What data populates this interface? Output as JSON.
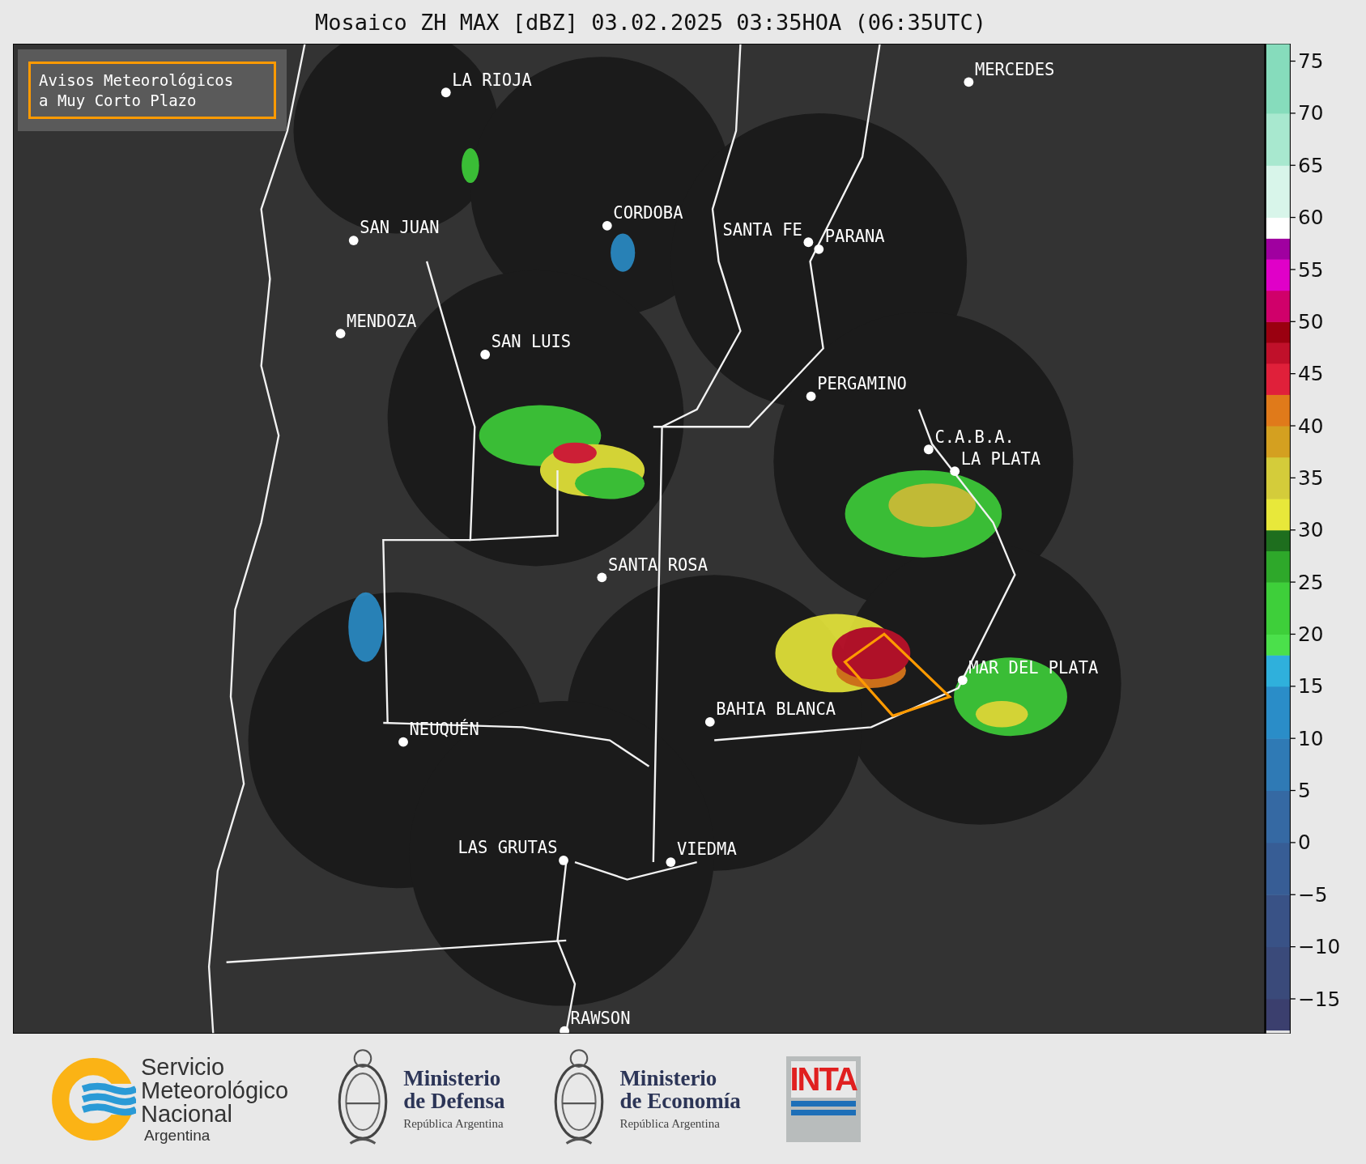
{
  "title": "Mosaico ZH MAX [dBZ] 03.02.2025 03:35HOA (06:35UTC)",
  "legend": {
    "lines": [
      "Avisos Meteorológicos",
      "a Muy Corto Plazo"
    ]
  },
  "cities": [
    {
      "name": "LA RIOJA"
    },
    {
      "name": "MERCEDES"
    },
    {
      "name": "SAN JUAN"
    },
    {
      "name": "CORDOBA"
    },
    {
      "name": "SANTA FE"
    },
    {
      "name": "PARANA"
    },
    {
      "name": "MENDOZA"
    },
    {
      "name": "SAN LUIS"
    },
    {
      "name": "PERGAMINO"
    },
    {
      "name": "C.A.B.A."
    },
    {
      "name": "LA PLATA"
    },
    {
      "name": "SANTA ROSA"
    },
    {
      "name": "MAR DEL PLATA"
    },
    {
      "name": "BAHIA BLANCA"
    },
    {
      "name": "NEUQUÉN"
    },
    {
      "name": "LAS GRUTAS"
    },
    {
      "name": "VIEDMA"
    },
    {
      "name": "RAWSON"
    }
  ],
  "colorbar": {
    "ticks": [
      "75",
      "70",
      "65",
      "60",
      "55",
      "50",
      "45",
      "40",
      "35",
      "30",
      "25",
      "20",
      "15",
      "10",
      "5",
      "0",
      "−5",
      "−10",
      "−15"
    ]
  },
  "logos": [
    {
      "kind": "smn",
      "lines": [
        "Servicio",
        "Meteorológico",
        "Nacional",
        "Argentina"
      ]
    },
    {
      "kind": "ministry",
      "lines": [
        "Ministerio",
        "de Defensa",
        "República Argentina"
      ]
    },
    {
      "kind": "ministry",
      "lines": [
        "Ministerio",
        "de Economía",
        "República Argentina"
      ]
    },
    {
      "kind": "inta",
      "lines": [
        "INTA"
      ]
    }
  ]
}
